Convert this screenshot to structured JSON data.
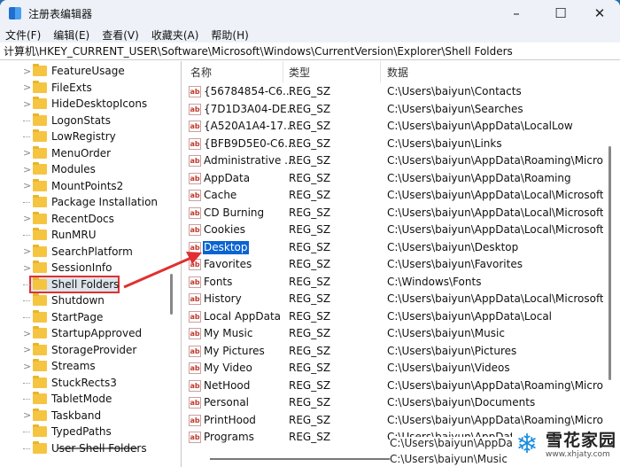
{
  "window": {
    "title": "注册表编辑器",
    "minimize": "–",
    "maximize": "☐",
    "close": "✕"
  },
  "menu": [
    "文件(F)",
    "编辑(E)",
    "查看(V)",
    "收藏夹(A)",
    "帮助(H)"
  ],
  "address": "计算机\\HKEY_CURRENT_USER\\Software\\Microsoft\\Windows\\CurrentVersion\\Explorer\\Shell Folders",
  "tree": [
    {
      "label": "FeatureUsage",
      "expandable": true
    },
    {
      "label": "FileExts",
      "expandable": true
    },
    {
      "label": "HideDesktopIcons",
      "expandable": true
    },
    {
      "label": "LogonStats",
      "expandable": false
    },
    {
      "label": "LowRegistry",
      "expandable": false
    },
    {
      "label": "MenuOrder",
      "expandable": true
    },
    {
      "label": "Modules",
      "expandable": true
    },
    {
      "label": "MountPoints2",
      "expandable": true
    },
    {
      "label": "Package Installation",
      "expandable": false
    },
    {
      "label": "RecentDocs",
      "expandable": true
    },
    {
      "label": "RunMRU",
      "expandable": false
    },
    {
      "label": "SearchPlatform",
      "expandable": true
    },
    {
      "label": "SessionInfo",
      "expandable": true
    },
    {
      "label": "Shell Folders",
      "expandable": false,
      "selected": true
    },
    {
      "label": "Shutdown",
      "expandable": false
    },
    {
      "label": "StartPage",
      "expandable": false
    },
    {
      "label": "StartupApproved",
      "expandable": true
    },
    {
      "label": "StorageProvider",
      "expandable": true
    },
    {
      "label": "Streams",
      "expandable": true
    },
    {
      "label": "StuckRects3",
      "expandable": false
    },
    {
      "label": "TabletMode",
      "expandable": false
    },
    {
      "label": "Taskband",
      "expandable": true
    },
    {
      "label": "TypedPaths",
      "expandable": false
    },
    {
      "label": "User Shell Folders",
      "expandable": false
    }
  ],
  "columns": {
    "name": "名称",
    "type": "类型",
    "data": "数据"
  },
  "values": [
    {
      "name": "{56784854-C6...",
      "type": "REG_SZ",
      "data": "C:\\Users\\baiyun\\Contacts"
    },
    {
      "name": "{7D1D3A04-DE...",
      "type": "REG_SZ",
      "data": "C:\\Users\\baiyun\\Searches"
    },
    {
      "name": "{A520A1A4-17...",
      "type": "REG_SZ",
      "data": "C:\\Users\\baiyun\\AppData\\LocalLow"
    },
    {
      "name": "{BFB9D5E0-C6...",
      "type": "REG_SZ",
      "data": "C:\\Users\\baiyun\\Links"
    },
    {
      "name": "Administrative ...",
      "type": "REG_SZ",
      "data": "C:\\Users\\baiyun\\AppData\\Roaming\\Microsof"
    },
    {
      "name": "AppData",
      "type": "REG_SZ",
      "data": "C:\\Users\\baiyun\\AppData\\Roaming"
    },
    {
      "name": "Cache",
      "type": "REG_SZ",
      "data": "C:\\Users\\baiyun\\AppData\\Local\\Microsoft\\W"
    },
    {
      "name": "CD Burning",
      "type": "REG_SZ",
      "data": "C:\\Users\\baiyun\\AppData\\Local\\Microsoft\\W"
    },
    {
      "name": "Cookies",
      "type": "REG_SZ",
      "data": "C:\\Users\\baiyun\\AppData\\Local\\Microsoft\\W"
    },
    {
      "name": "Desktop",
      "type": "REG_SZ",
      "data": "C:\\Users\\baiyun\\Desktop",
      "selected": true
    },
    {
      "name": "Favorites",
      "type": "REG_SZ",
      "data": "C:\\Users\\baiyun\\Favorites"
    },
    {
      "name": "Fonts",
      "type": "REG_SZ",
      "data": "C:\\Windows\\Fonts"
    },
    {
      "name": "History",
      "type": "REG_SZ",
      "data": "C:\\Users\\baiyun\\AppData\\Local\\Microsoft\\W"
    },
    {
      "name": "Local AppData",
      "type": "REG_SZ",
      "data": "C:\\Users\\baiyun\\AppData\\Local"
    },
    {
      "name": "My Music",
      "type": "REG_SZ",
      "data": "C:\\Users\\baiyun\\Music"
    },
    {
      "name": "My Pictures",
      "type": "REG_SZ",
      "data": "C:\\Users\\baiyun\\Pictures"
    },
    {
      "name": "My Video",
      "type": "REG_SZ",
      "data": "C:\\Users\\baiyun\\Videos"
    },
    {
      "name": "NetHood",
      "type": "REG_SZ",
      "data": "C:\\Users\\baiyun\\AppData\\Roaming\\Microsof"
    },
    {
      "name": "Personal",
      "type": "REG_SZ",
      "data": "C:\\Users\\baiyun\\Documents"
    },
    {
      "name": "PrintHood",
      "type": "REG_SZ",
      "data": "C:\\Users\\baiyun\\AppData\\Roaming\\Microsof"
    },
    {
      "name": "Programs",
      "type": "REG_SZ",
      "data": "C:\\Users\\baiyun\\AppData\\Roaming\\Microsof"
    }
  ],
  "overlay_lines": [
    "C:\\Users\\baiyun\\AppDa",
    "C:\\Users\\baiyun\\Music"
  ],
  "watermark": {
    "name": "雪花家园",
    "url": "www.xhjaty.com"
  },
  "colors": {
    "selection": "#0a64d2",
    "annotation": "#e03030",
    "watermark": "#1a8fe0"
  }
}
